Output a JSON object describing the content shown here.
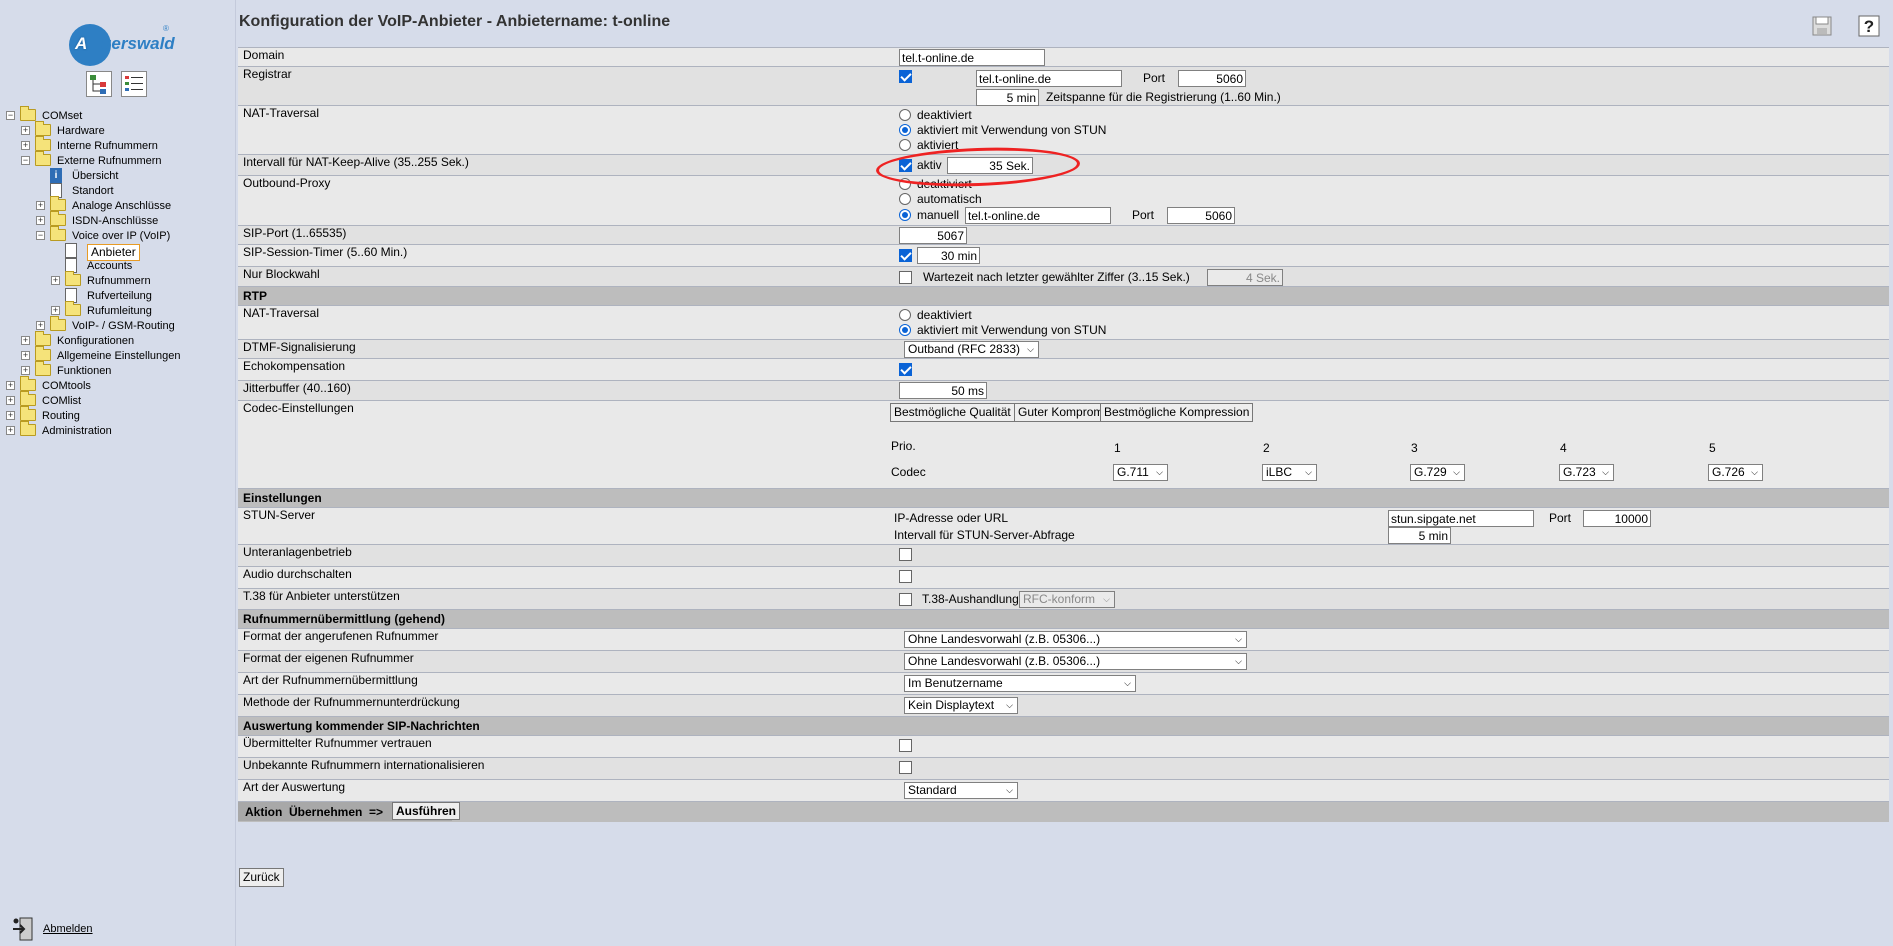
{
  "sidebar": {
    "logo_text_a": "A",
    "logo_text_b": "uerswald",
    "logo_reg": "®",
    "tree": [
      {
        "label": "COMset",
        "level": 0,
        "expander": "−",
        "icon": "folder-open"
      },
      {
        "label": "Hardware",
        "level": 1,
        "expander": "+",
        "icon": "folder"
      },
      {
        "label": "Interne Rufnummern",
        "level": 1,
        "expander": "+",
        "icon": "folder"
      },
      {
        "label": "Externe Rufnummern",
        "level": 1,
        "expander": "−",
        "icon": "folder-open"
      },
      {
        "label": "Übersicht",
        "level": 2,
        "expander": "",
        "icon": "info"
      },
      {
        "label": "Standort",
        "level": 2,
        "expander": "",
        "icon": "document"
      },
      {
        "label": "Analoge Anschlüsse",
        "level": 2,
        "expander": "+",
        "icon": "folder"
      },
      {
        "label": "ISDN-Anschlüsse",
        "level": 2,
        "expander": "+",
        "icon": "folder"
      },
      {
        "label": "Voice over IP (VoIP)",
        "level": 2,
        "expander": "−",
        "icon": "folder-open"
      },
      {
        "label": "Anbieter",
        "level": 3,
        "expander": "",
        "icon": "document",
        "selected": true
      },
      {
        "label": "Accounts",
        "level": 3,
        "expander": "",
        "icon": "document"
      },
      {
        "label": "Rufnummern",
        "level": 3,
        "expander": "+",
        "icon": "folder"
      },
      {
        "label": "Rufverteilung",
        "level": 3,
        "expander": "",
        "icon": "document"
      },
      {
        "label": "Rufumleitung",
        "level": 3,
        "expander": "+",
        "icon": "folder"
      },
      {
        "label": "VoIP- / GSM-Routing",
        "level": 2,
        "expander": "+",
        "icon": "folder"
      },
      {
        "label": "Konfigurationen",
        "level": 1,
        "expander": "+",
        "icon": "folder"
      },
      {
        "label": "Allgemeine Einstellungen",
        "level": 1,
        "expander": "+",
        "icon": "folder"
      },
      {
        "label": "Funktionen",
        "level": 1,
        "expander": "+",
        "icon": "folder"
      },
      {
        "label": "COMtools",
        "level": 0,
        "expander": "+",
        "icon": "folder"
      },
      {
        "label": "COMlist",
        "level": 0,
        "expander": "+",
        "icon": "folder"
      },
      {
        "label": "Routing",
        "level": 0,
        "expander": "+",
        "icon": "folder"
      },
      {
        "label": "Administration",
        "level": 0,
        "expander": "+",
        "icon": "folder"
      }
    ],
    "logout": "Abmelden"
  },
  "page_title": "Konfiguration der VoIP-Anbieter - Anbietername: t-online",
  "labels": {
    "domain": "Domain",
    "registrar": "Registrar",
    "nat": "NAT-Traversal",
    "keepalive": "Intervall für NAT-Keep-Alive (35..255 Sek.)",
    "outbound": "Outbound-Proxy",
    "sipport": "SIP-Port (1..65535)",
    "session": "SIP-Session-Timer (5..60 Min.)",
    "block": "Nur Blockwahl",
    "rtp": "RTP",
    "rtp_nat": "NAT-Traversal",
    "dtmf": "DTMF-Signalisierung",
    "echo": "Echokompensation",
    "jitter": "Jitterbuffer (40..160)",
    "codec": "Codec-Einstellungen",
    "einst": "Einstellungen",
    "stun": "STUN-Server",
    "unter": "Unteranlagenbetrieb",
    "audio": "Audio durchschalten",
    "t38": "T.38 für Anbieter unterstützen",
    "rufhd": "Rufnummernübermittlung (gehend)",
    "fmt_ang": "Format der angerufenen Rufnummer",
    "fmt_eig": "Format der eigenen Rufnummer",
    "art_uebm": "Art der Rufnummernübermittlung",
    "methode": "Methode der Rufnummernunterdrückung",
    "ausw": "Auswertung kommender SIP-Nachrichten",
    "vertrauen": "Übermittelter Rufnummer vertrauen",
    "intl": "Unbekannte Rufnummern internationalisieren",
    "art_ausw": "Art der Auswertung"
  },
  "values": {
    "domain": "tel.t-online.de",
    "registrar_host": "tel.t-online.de",
    "port_label": "Port",
    "registrar_port": "5060",
    "reg_interval": "5 min",
    "reg_interval_note": "Zeitspanne für die Registrierung (1..60 Min.)",
    "nat_opt1": "deaktiviert",
    "nat_opt2": "aktiviert mit Verwendung von STUN",
    "nat_opt3": "aktiviert",
    "keep_label": "aktiv",
    "keep_val": "35 Sek.",
    "ob_opt1": "deaktiviert",
    "ob_opt2": "automatisch",
    "ob_opt3": "manuell",
    "ob_host": "tel.t-online.de",
    "ob_port": "5060",
    "sipport": "5067",
    "session": "30 min",
    "block_note": "Wartezeit nach letzter gewählter Ziffer (3..15 Sek.)",
    "block_val": "4 Sek.",
    "rtp_opt1": "deaktiviert",
    "rtp_opt2": "aktiviert mit Verwendung von STUN",
    "dtmf": "Outband (RFC 2833)",
    "jitter": "50 ms",
    "codec_b1": "Bestmögliche Qualität",
    "codec_b2": "Guter Kompromiss",
    "codec_b3": "Bestmögliche Kompression",
    "prio": "Prio.",
    "codec": "Codec",
    "prios": [
      "1",
      "2",
      "3",
      "4",
      "5"
    ],
    "codecs": [
      "G.711",
      "iLBC",
      "G.729",
      "G.723",
      "G.726"
    ],
    "stun_ip_label": "IP-Adresse oder URL",
    "stun_ip": "stun.sipgate.net",
    "stun_port": "10000",
    "stun_int_label": "Intervall für STUN-Server-Abfrage",
    "stun_int": "5 min",
    "t38_label": "T.38-Aushandlung",
    "t38_val": "RFC-konform",
    "fmt_ang": "Ohne Landesvorwahl (z.B. 05306...)",
    "fmt_eig": "Ohne Landesvorwahl (z.B. 05306...)",
    "art_uebm": "Im Benutzername",
    "methode": "Kein Displaytext",
    "art_ausw": "Standard"
  },
  "action": {
    "label": "Aktion  Übernehmen  =>",
    "execute": "Ausführen",
    "back": "Zurück"
  },
  "colors": {
    "accent": "#0a63d6",
    "highlight": "#e22222",
    "header": "#bdbdbd",
    "bg": "#d6dcea"
  }
}
